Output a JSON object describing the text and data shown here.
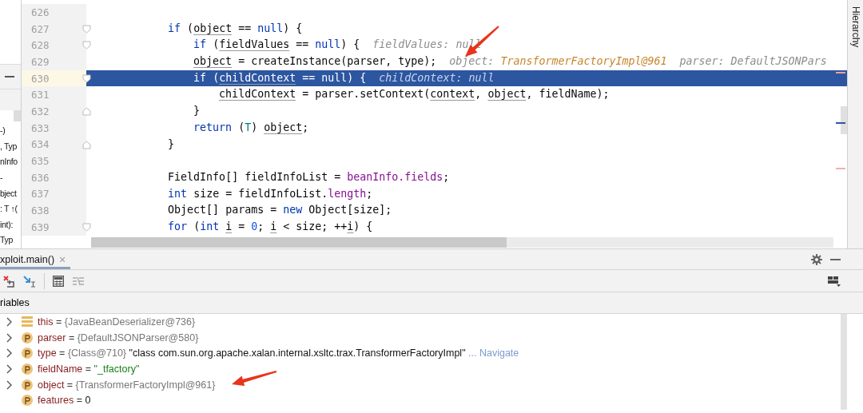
{
  "left_panel": {
    "items": [
      "-)",
      ", Typ",
      "nInfo",
      "-",
      "bject",
      ": T ↑(",
      "int):",
      "Typ"
    ]
  },
  "editor": {
    "lines": [
      {
        "number": "626",
        "current": false,
        "kind": "plain"
      },
      {
        "number": "627",
        "current": false,
        "kind": "fold_start",
        "tokens": [
          {
            "kind": "kw",
            "text": "            if"
          },
          {
            "kind": "plain",
            "text": " ("
          },
          {
            "kind": "var",
            "text": "object"
          },
          {
            "kind": "plain",
            "text": " == "
          },
          {
            "kind": "kw",
            "text": "null"
          },
          {
            "kind": "plain",
            "text": ") {"
          }
        ]
      },
      {
        "number": "628",
        "current": false,
        "kind": "fold_start",
        "tokens": [
          {
            "kind": "kw",
            "text": "                if"
          },
          {
            "kind": "plain",
            "text": " ("
          },
          {
            "kind": "var",
            "text": "fieldValues"
          },
          {
            "kind": "plain",
            "text": " == "
          },
          {
            "kind": "kw",
            "text": "null"
          },
          {
            "kind": "plain",
            "text": ") {"
          }
        ],
        "hints": [
          {
            "name": "fieldValues:",
            "value": "null",
            "kind": "plain"
          }
        ]
      },
      {
        "number": "629",
        "current": false,
        "kind": "plain",
        "arrow": true,
        "tokens": [
          {
            "kind": "var",
            "text": "                object"
          },
          {
            "kind": "plain",
            "text": " = createInstance(parser, type);"
          }
        ],
        "hints": [
          {
            "name": "object:",
            "value": "TransformerFactoryImpl@961",
            "kind": "object"
          },
          {
            "name": "parser:",
            "value": "DefaultJSONPars",
            "kind": "plain"
          }
        ]
      },
      {
        "number": "630",
        "current": true,
        "kind": "fold_start",
        "tokens": [
          {
            "kind": "kw",
            "text": "                if"
          },
          {
            "kind": "plain",
            "text": " ("
          },
          {
            "kind": "var",
            "text": "childContext"
          },
          {
            "kind": "plain",
            "text": " == "
          },
          {
            "kind": "kw",
            "text": "null"
          },
          {
            "kind": "plain",
            "text": ") {"
          }
        ],
        "hints": [
          {
            "name": "childContext:",
            "value": "null",
            "kind": "plain"
          }
        ]
      },
      {
        "number": "631",
        "current": false,
        "kind": "plain",
        "tokens": [
          {
            "kind": "var",
            "text": "                    childContext"
          },
          {
            "kind": "plain",
            "text": " = parser.setContext("
          },
          {
            "kind": "var",
            "text": "context"
          },
          {
            "kind": "plain",
            "text": ", "
          },
          {
            "kind": "var",
            "text": "object"
          },
          {
            "kind": "plain",
            "text": ", fieldName);"
          }
        ]
      },
      {
        "number": "632",
        "current": false,
        "kind": "fold_end",
        "tokens": [
          {
            "kind": "plain",
            "text": "                }"
          }
        ]
      },
      {
        "number": "633",
        "current": false,
        "kind": "plain",
        "tokens": [
          {
            "kind": "kw",
            "text": "                return"
          },
          {
            "kind": "plain",
            "text": " ("
          },
          {
            "kind": "type",
            "text": "T"
          },
          {
            "kind": "plain",
            "text": ") "
          },
          {
            "kind": "var",
            "text": "object"
          },
          {
            "kind": "plain",
            "text": ";"
          }
        ]
      },
      {
        "number": "634",
        "current": false,
        "kind": "fold_end",
        "tokens": [
          {
            "kind": "plain",
            "text": "            }"
          }
        ]
      },
      {
        "number": "635",
        "current": false,
        "kind": "plain"
      },
      {
        "number": "636",
        "current": false,
        "kind": "plain",
        "tokens": [
          {
            "kind": "plain",
            "text": "            FieldInfo[] fieldInfoList = "
          },
          {
            "kind": "field",
            "text": "beanInfo.fields"
          },
          {
            "kind": "plain",
            "text": ";"
          }
        ]
      },
      {
        "number": "637",
        "current": false,
        "kind": "plain",
        "tokens": [
          {
            "kind": "kw",
            "text": "            int"
          },
          {
            "kind": "plain",
            "text": " size = fieldInfoList."
          },
          {
            "kind": "field",
            "text": "length"
          },
          {
            "kind": "plain",
            "text": ";"
          }
        ]
      },
      {
        "number": "638",
        "current": false,
        "kind": "plain",
        "tokens": [
          {
            "kind": "plain",
            "text": "            Object[] params = "
          },
          {
            "kind": "kw",
            "text": "new"
          },
          {
            "kind": "plain",
            "text": " Object[size];"
          }
        ]
      },
      {
        "number": "639",
        "current": false,
        "kind": "fold_start",
        "tokens": [
          {
            "kind": "kw",
            "text": "            for"
          },
          {
            "kind": "plain",
            "text": " ("
          },
          {
            "kind": "kw",
            "text": "int "
          },
          {
            "kind": "var",
            "text": "i"
          },
          {
            "kind": "plain",
            "text": " = "
          },
          {
            "kind": "num",
            "text": "0"
          },
          {
            "kind": "plain",
            "text": "; "
          },
          {
            "kind": "var",
            "text": "i"
          },
          {
            "kind": "plain",
            "text": " < size; ++"
          },
          {
            "kind": "var",
            "text": "i"
          },
          {
            "kind": "plain",
            "text": ") {"
          }
        ]
      }
    ]
  },
  "side_tab": {
    "label": "Hierarchy"
  },
  "debug": {
    "tab": {
      "label": "xploit.main()",
      "selected": true,
      "close": "×"
    },
    "section": "riables",
    "variables": [
      {
        "name": "this",
        "kind": "fields",
        "expandable": true,
        "operator": "=",
        "value": {
          "kind": "object",
          "text": "{JavaBeanDeserializer@736}"
        }
      },
      {
        "name": "parser",
        "kind": "parameter",
        "expandable": true,
        "operator": "=",
        "value": {
          "kind": "object",
          "text": "{DefaultJSONParser@580}"
        }
      },
      {
        "name": "type",
        "kind": "parameter",
        "expandable": true,
        "operator": "=",
        "value": {
          "kind": "object",
          "text": "{Class@710}"
        },
        "detail": "\"class com.sun.org.apache.xalan.internal.xsltc.trax.TransformerFactoryImpl\"",
        "link": "... Navigate"
      },
      {
        "name": "fieldName",
        "kind": "parameter",
        "expandable": true,
        "operator": "=",
        "value": {
          "kind": "string",
          "text": "\"_tfactory\""
        }
      },
      {
        "name": "object",
        "kind": "parameter",
        "expandable": true,
        "operator": "=",
        "value": {
          "kind": "object",
          "text": "{TransformerFactoryImpl@961}"
        },
        "arrow": true
      },
      {
        "name": "features",
        "kind": "parameter",
        "expandable": false,
        "operator": "=",
        "value": {
          "kind": "number",
          "text": "0"
        }
      }
    ]
  }
}
